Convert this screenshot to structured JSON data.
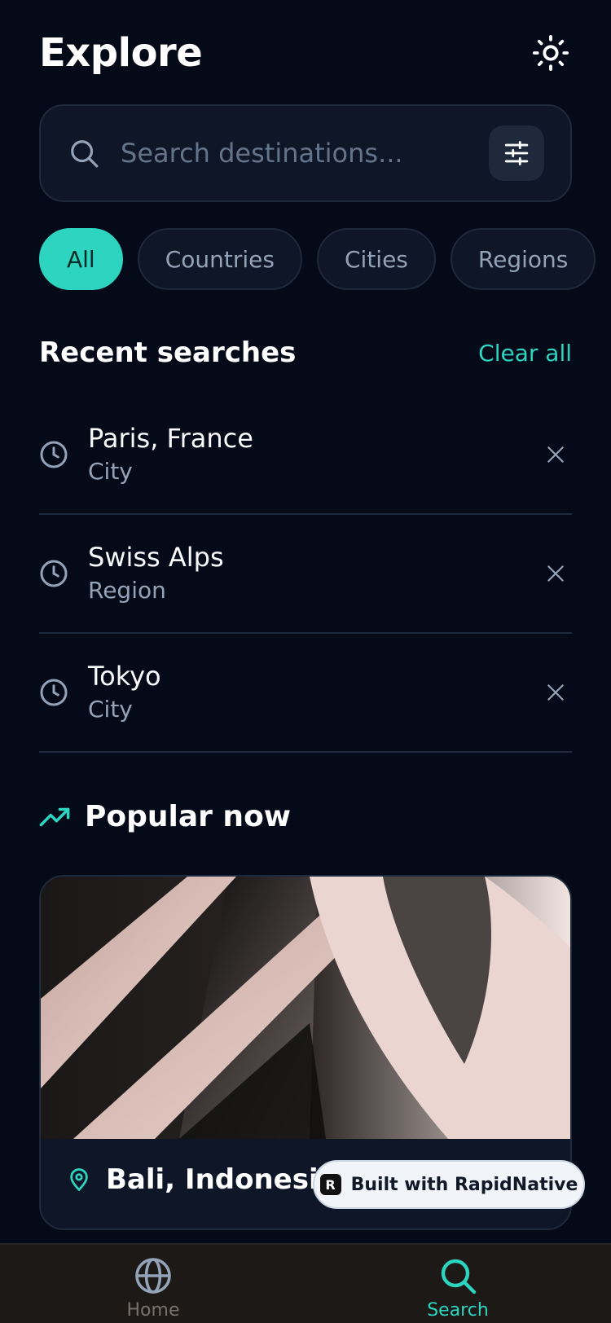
{
  "header": {
    "title": "Explore",
    "theme_toggle_icon": "sun-icon"
  },
  "search": {
    "placeholder": "Search destinations...",
    "value": "",
    "search_icon": "search-icon",
    "filter_icon": "sliders-icon"
  },
  "filters": {
    "chips": [
      {
        "label": "All",
        "active": true
      },
      {
        "label": "Countries",
        "active": false
      },
      {
        "label": "Cities",
        "active": false
      },
      {
        "label": "Regions",
        "active": false
      }
    ]
  },
  "recent": {
    "title": "Recent searches",
    "clear_label": "Clear all",
    "items": [
      {
        "name": "Paris, France",
        "type": "City"
      },
      {
        "name": "Swiss Alps",
        "type": "Region"
      },
      {
        "name": "Tokyo",
        "type": "City"
      }
    ]
  },
  "popular": {
    "title": "Popular now",
    "icon": "trending-up-icon",
    "cards": [
      {
        "title": "Bali, Indonesia",
        "icon": "map-pin-icon"
      }
    ]
  },
  "badge": {
    "label": "Built with RapidNative",
    "logo_text": "R"
  },
  "nav": {
    "items": [
      {
        "label": "Home",
        "icon": "globe-icon",
        "active": false
      },
      {
        "label": "Search",
        "icon": "search-icon",
        "active": true
      }
    ]
  },
  "colors": {
    "background": "#050a19",
    "accent": "#2dd4bf",
    "surface": "#0e1627",
    "muted": "#94a3b8"
  }
}
